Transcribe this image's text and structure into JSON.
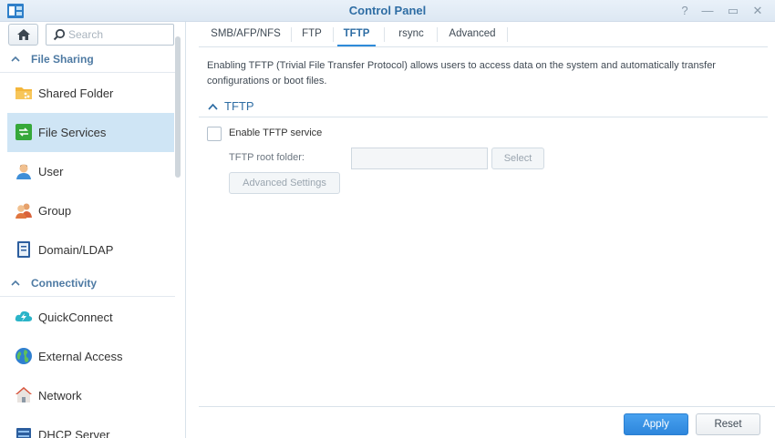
{
  "window": {
    "title": "Control Panel",
    "controls": {
      "help": "?",
      "minimize": "—",
      "maximize": "▭",
      "close": "✕"
    }
  },
  "sidebar": {
    "search_placeholder": "Search",
    "sections": [
      {
        "label": "File Sharing"
      },
      {
        "label": "Connectivity"
      }
    ],
    "items": [
      {
        "label": "Shared Folder",
        "icon": "shared-folder-icon"
      },
      {
        "label": "File Services",
        "icon": "file-services-icon",
        "active": true
      },
      {
        "label": "User",
        "icon": "user-icon"
      },
      {
        "label": "Group",
        "icon": "group-icon"
      },
      {
        "label": "Domain/LDAP",
        "icon": "domain-ldap-icon"
      },
      {
        "label": "QuickConnect",
        "icon": "quickconnect-icon"
      },
      {
        "label": "External Access",
        "icon": "external-access-icon"
      },
      {
        "label": "Network",
        "icon": "network-icon"
      },
      {
        "label": "DHCP Server",
        "icon": "dhcp-server-icon"
      }
    ]
  },
  "tabs": [
    {
      "label": "SMB/AFP/NFS"
    },
    {
      "label": "FTP"
    },
    {
      "label": "TFTP",
      "active": true
    },
    {
      "label": "rsync"
    },
    {
      "label": "Advanced"
    }
  ],
  "main": {
    "description": "Enabling TFTP (Trivial File Transfer Protocol) allows users to access data on the system and automatically transfer configurations or boot files.",
    "group_title": "TFTP",
    "enable_label": "Enable TFTP service",
    "enable_checked": false,
    "root_folder_label": "TFTP root folder:",
    "root_folder_value": "",
    "select_button": "Select",
    "advanced_settings_button": "Advanced Settings"
  },
  "footer": {
    "apply": "Apply",
    "reset": "Reset"
  },
  "colors": {
    "accent": "#2e6da4",
    "active_item_bg": "#cfe5f5",
    "apply_bg": "#2d86dc"
  }
}
